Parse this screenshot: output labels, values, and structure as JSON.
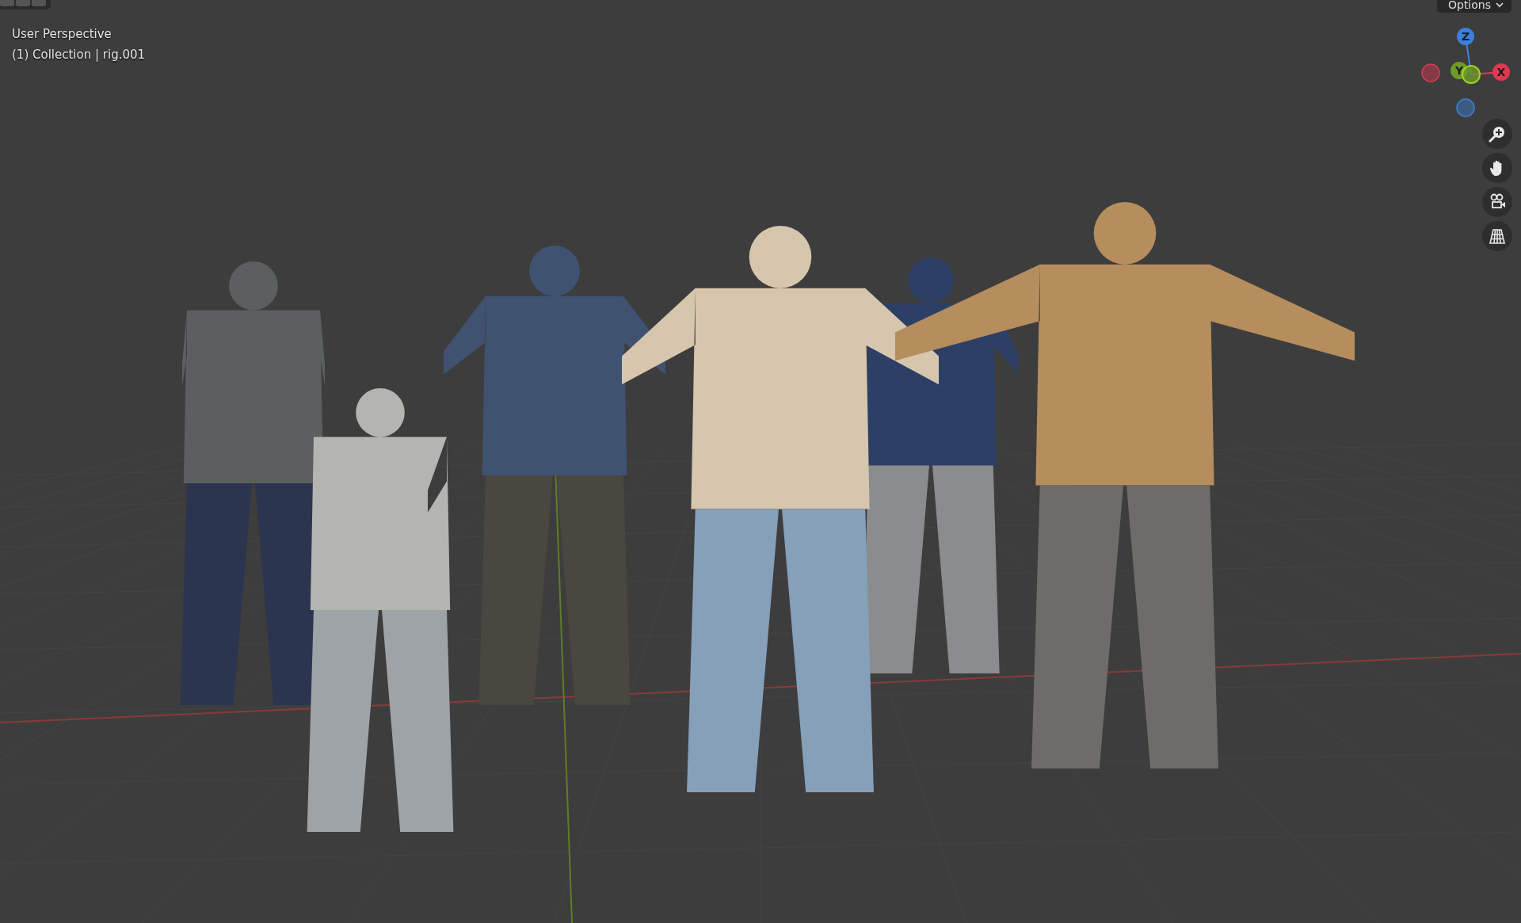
{
  "viewport": {
    "title": "User Perspective",
    "context": "(1) Collection | rig.001"
  },
  "header": {
    "options_label": "Options"
  },
  "gizmo": {
    "axes": [
      {
        "label": "Z",
        "color": "#3b80dc"
      },
      {
        "label": "Y",
        "color": "#6e9a2a"
      },
      {
        "label": "X",
        "color": "#dc3a52"
      }
    ]
  }
}
